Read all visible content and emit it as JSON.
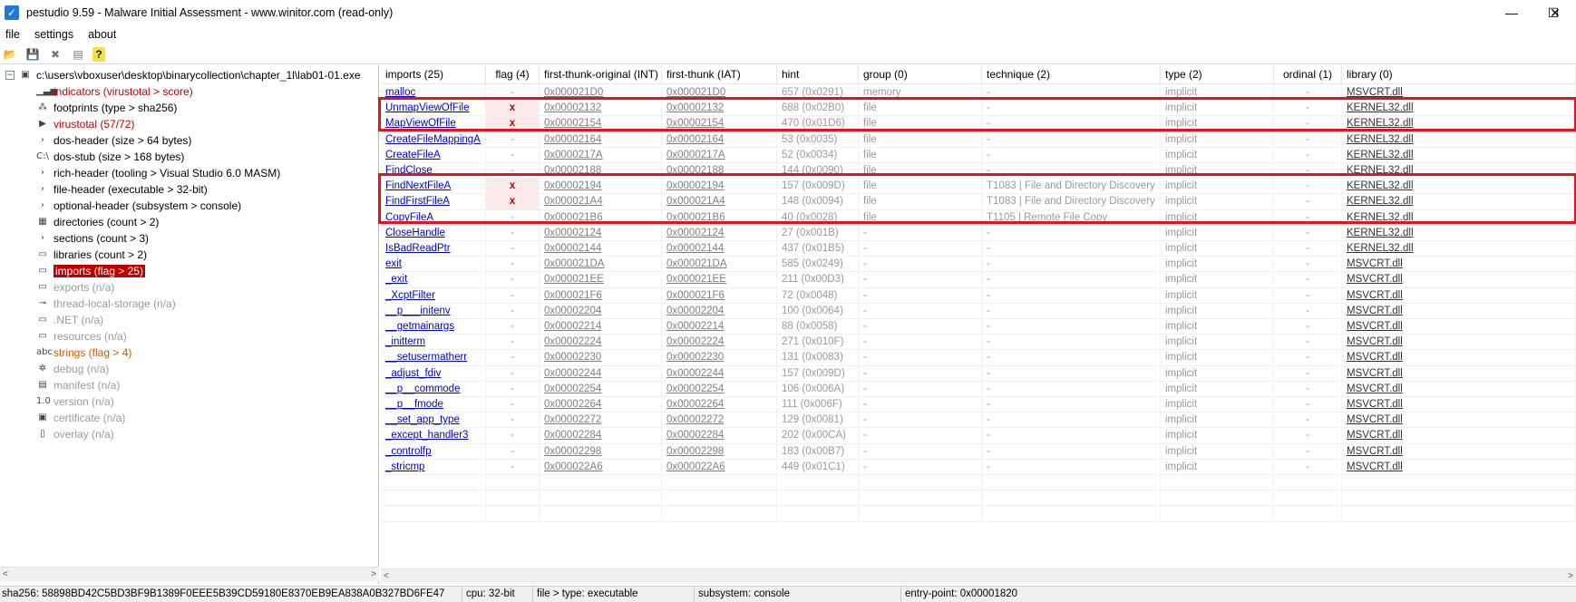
{
  "window": {
    "title": "pestudio 9.59 - Malware Initial Assessment - www.winitor.com (read-only)",
    "minimize": "—",
    "maximize": "☐",
    "close": "✕"
  },
  "menu": [
    "file",
    "settings",
    "about"
  ],
  "toolbar": {
    "open": "📂",
    "save": "💾",
    "close": "✖",
    "list": "▤",
    "help": "?"
  },
  "tree": {
    "root": "c:\\users\\vboxuser\\desktop\\binarycollection\\chapter_1l\\lab01-01.exe",
    "items": [
      {
        "label": "indicators (virustotal > score)",
        "style": "red",
        "icon": "▁▃▅"
      },
      {
        "label": "footprints (type > sha256)",
        "style": "normal",
        "icon": "⁂"
      },
      {
        "label": "virustotal (57/72)",
        "style": "red",
        "icon": "▶"
      },
      {
        "label": "dos-header (size > 64 bytes)",
        "style": "normal",
        "icon": "›"
      },
      {
        "label": "dos-stub (size > 168 bytes)",
        "style": "normal",
        "icon": "C:\\"
      },
      {
        "label": "rich-header (tooling > Visual Studio 6.0 MASM)",
        "style": "normal",
        "icon": "›"
      },
      {
        "label": "file-header (executable > 32-bit)",
        "style": "normal",
        "icon": "›"
      },
      {
        "label": "optional-header (subsystem > console)",
        "style": "normal",
        "icon": "›"
      },
      {
        "label": "directories (count > 2)",
        "style": "normal",
        "icon": "▦"
      },
      {
        "label": "sections (count > 3)",
        "style": "normal",
        "icon": "›"
      },
      {
        "label": "libraries (count > 2)",
        "style": "normal",
        "icon": "▭"
      },
      {
        "label": "imports (flag > 25)",
        "style": "selected",
        "icon": "▭"
      },
      {
        "label": "exports (n/a)",
        "style": "gray",
        "icon": "▭"
      },
      {
        "label": "thread-local-storage (n/a)",
        "style": "gray",
        "icon": "⊸"
      },
      {
        "label": ".NET (n/a)",
        "style": "gray",
        "icon": "▭"
      },
      {
        "label": "resources (n/a)",
        "style": "gray",
        "icon": "▭"
      },
      {
        "label": "strings (flag > 4)",
        "style": "orange",
        "icon": "abc"
      },
      {
        "label": "debug (n/a)",
        "style": "gray",
        "icon": "✲"
      },
      {
        "label": "manifest (n/a)",
        "style": "gray",
        "icon": "▤"
      },
      {
        "label": "version (n/a)",
        "style": "gray",
        "icon": "1.0"
      },
      {
        "label": "certificate (n/a)",
        "style": "gray",
        "icon": "▣"
      },
      {
        "label": "overlay (n/a)",
        "style": "gray",
        "icon": "▯"
      }
    ]
  },
  "table": {
    "columns": [
      "imports (25)",
      "flag (4)",
      "first-thunk-original (INT)",
      "first-thunk (IAT)",
      "hint",
      "group (0)",
      "technique (2)",
      "type (2)",
      "ordinal (1)",
      "library (0)"
    ],
    "rows": [
      [
        "malloc",
        "-",
        "0x000021D0",
        "0x000021D0",
        "657 (0x0291)",
        "memory",
        "-",
        "implicit",
        "-",
        "MSVCRT.dll"
      ],
      [
        "UnmapViewOfFile",
        "x",
        "0x00002132",
        "0x00002132",
        "688 (0x02B0)",
        "file",
        "-",
        "implicit",
        "-",
        "KERNEL32.dll"
      ],
      [
        "MapViewOfFile",
        "x",
        "0x00002154",
        "0x00002154",
        "470 (0x01D6)",
        "file",
        "-",
        "implicit",
        "-",
        "KERNEL32.dll"
      ],
      [
        "CreateFileMappingA",
        "-",
        "0x00002164",
        "0x00002164",
        "53 (0x0035)",
        "file",
        "-",
        "implicit",
        "-",
        "KERNEL32.dll"
      ],
      [
        "CreateFileA",
        "-",
        "0x0000217A",
        "0x0000217A",
        "52 (0x0034)",
        "file",
        "-",
        "implicit",
        "-",
        "KERNEL32.dll"
      ],
      [
        "FindClose",
        "-",
        "0x00002188",
        "0x00002188",
        "144 (0x0090)",
        "file",
        "-",
        "implicit",
        "-",
        "KERNEL32.dll"
      ],
      [
        "FindNextFileA",
        "x",
        "0x00002194",
        "0x00002194",
        "157 (0x009D)",
        "file",
        "T1083 | File and Directory Discovery",
        "implicit",
        "-",
        "KERNEL32.dll"
      ],
      [
        "FindFirstFileA",
        "x",
        "0x000021A4",
        "0x000021A4",
        "148 (0x0094)",
        "file",
        "T1083 | File and Directory Discovery",
        "implicit",
        "-",
        "KERNEL32.dll"
      ],
      [
        "CopyFileA",
        "-",
        "0x000021B6",
        "0x000021B6",
        "40 (0x0028)",
        "file",
        "T1105 | Remote File Copy",
        "implicit",
        "-",
        "KERNEL32.dll"
      ],
      [
        "CloseHandle",
        "-",
        "0x00002124",
        "0x00002124",
        "27 (0x001B)",
        "-",
        "-",
        "implicit",
        "-",
        "KERNEL32.dll"
      ],
      [
        "IsBadReadPtr",
        "-",
        "0x00002144",
        "0x00002144",
        "437 (0x01B5)",
        "-",
        "-",
        "implicit",
        "-",
        "KERNEL32.dll"
      ],
      [
        "exit",
        "-",
        "0x000021DA",
        "0x000021DA",
        "585 (0x0249)",
        "-",
        "-",
        "implicit",
        "-",
        "MSVCRT.dll"
      ],
      [
        "_exit",
        "-",
        "0x000021EE",
        "0x000021EE",
        "211 (0x00D3)",
        "-",
        "-",
        "implicit",
        "-",
        "MSVCRT.dll"
      ],
      [
        "_XcptFilter",
        "-",
        "0x000021F6",
        "0x000021F6",
        "72 (0x0048)",
        "-",
        "-",
        "implicit",
        "-",
        "MSVCRT.dll"
      ],
      [
        "__p___initenv",
        "-",
        "0x00002204",
        "0x00002204",
        "100 (0x0064)",
        "-",
        "-",
        "implicit",
        "-",
        "MSVCRT.dll"
      ],
      [
        "__getmainargs",
        "-",
        "0x00002214",
        "0x00002214",
        "88 (0x0058)",
        "-",
        "-",
        "implicit",
        "-",
        "MSVCRT.dll"
      ],
      [
        "_initterm",
        "-",
        "0x00002224",
        "0x00002224",
        "271 (0x010F)",
        "-",
        "-",
        "implicit",
        "-",
        "MSVCRT.dll"
      ],
      [
        "__setusermatherr",
        "-",
        "0x00002230",
        "0x00002230",
        "131 (0x0083)",
        "-",
        "-",
        "implicit",
        "-",
        "MSVCRT.dll"
      ],
      [
        "_adjust_fdiv",
        "-",
        "0x00002244",
        "0x00002244",
        "157 (0x009D)",
        "-",
        "-",
        "implicit",
        "-",
        "MSVCRT.dll"
      ],
      [
        "__p__commode",
        "-",
        "0x00002254",
        "0x00002254",
        "106 (0x006A)",
        "-",
        "-",
        "implicit",
        "-",
        "MSVCRT.dll"
      ],
      [
        "__p__fmode",
        "-",
        "0x00002264",
        "0x00002264",
        "111 (0x006F)",
        "-",
        "-",
        "implicit",
        "-",
        "MSVCRT.dll"
      ],
      [
        "__set_app_type",
        "-",
        "0x00002272",
        "0x00002272",
        "129 (0x0081)",
        "-",
        "-",
        "implicit",
        "-",
        "MSVCRT.dll"
      ],
      [
        "_except_handler3",
        "-",
        "0x00002284",
        "0x00002284",
        "202 (0x00CA)",
        "-",
        "-",
        "implicit",
        "-",
        "MSVCRT.dll"
      ],
      [
        "_controlfp",
        "-",
        "0x00002298",
        "0x00002298",
        "183 (0x00B7)",
        "-",
        "-",
        "implicit",
        "-",
        "MSVCRT.dll"
      ],
      [
        "_stricmp",
        "-",
        "0x000022A6",
        "0x000022A6",
        "449 (0x01C1)",
        "-",
        "-",
        "implicit",
        "-",
        "MSVCRT.dll"
      ]
    ]
  },
  "status": {
    "sha256": "sha256: 58898BD42C5BD3BF9B1389F0EEE5B39CD59180E8370EB9EA838A0B327BD6FE47",
    "cpu": "cpu: 32-bit",
    "file_type": "file > type: executable",
    "subsystem": "subsystem: console",
    "entry_point": "entry-point: 0x00001820"
  },
  "colors": {
    "highlight_box": "#e0141e",
    "flag": "#c00000",
    "link": "#0000cc"
  }
}
